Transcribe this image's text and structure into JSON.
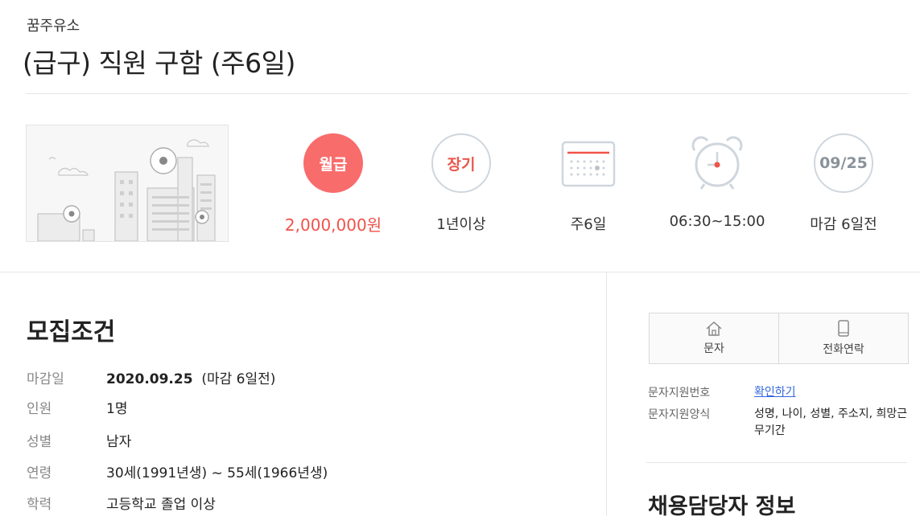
{
  "header": {
    "company": "꿈주유소",
    "title": "(급구) 직원 구함 (주6일)"
  },
  "summary": [
    {
      "badge": "월급",
      "label": "2,000,000원",
      "icon": "pay-badge"
    },
    {
      "badge": "장기",
      "label": "1년이상",
      "icon": "period-badge"
    },
    {
      "badge": "",
      "label": "주6일",
      "icon": "calendar-icon"
    },
    {
      "badge": "",
      "label": "06:30~15:00",
      "icon": "alarm-clock-icon"
    },
    {
      "badge": "09/25",
      "label": "마감 6일전",
      "icon": "deadline-badge"
    }
  ],
  "conditions": {
    "title": "모집조건",
    "rows": [
      {
        "key": "마감일",
        "value_bold": "2020.09.25",
        "value": "(마감 6일전)"
      },
      {
        "key": "인원",
        "value_bold": "",
        "value": "1명"
      },
      {
        "key": "성별",
        "value_bold": "",
        "value": "남자"
      },
      {
        "key": "연령",
        "value_bold": "",
        "value": "30세(1991년생) ~ 55세(1966년생)"
      },
      {
        "key": "학력",
        "value_bold": "",
        "value": "고등학교 졸업 이상"
      }
    ]
  },
  "sidebar": {
    "sms_label": "문자",
    "call_label": "전화연락",
    "sms_number_key": "문자지원번호",
    "sms_number_link": "확인하기",
    "sms_format_key": "문자지원양식",
    "sms_format_value": "성명, 나이, 성별, 주소지, 희망근무기간",
    "manager_title": "채용담당자 정보"
  },
  "colors": {
    "accent": "#f86c6b",
    "accent_text": "#f0524a",
    "link": "#3366dd"
  }
}
